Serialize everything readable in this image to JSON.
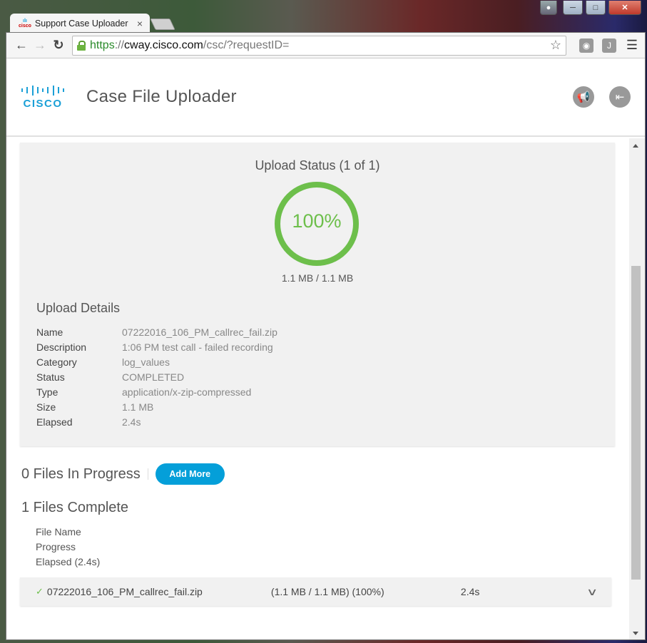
{
  "window": {
    "tab_title": "Support Case Uploader",
    "tab_close": "×",
    "favicon_text": "cisco"
  },
  "toolbar": {
    "url_scheme": "https",
    "url_sep": "://",
    "url_host": "cway.cisco.com",
    "url_path": "/csc/?requestID=",
    "extension_label": "J"
  },
  "header": {
    "logo_text": "CISCO",
    "title": "Case File Uploader"
  },
  "status": {
    "title": "Upload Status (1 of 1)",
    "percent_label": "100%",
    "progress_fraction": 1.0,
    "ring_color": "#6dbf4b",
    "size_label": "1.1 MB / 1.1 MB"
  },
  "details": {
    "title": "Upload Details",
    "rows": [
      {
        "label": "Name",
        "value": "07222016_106_PM_callrec_fail.zip"
      },
      {
        "label": "Description",
        "value": "1:06 PM test call - failed recording"
      },
      {
        "label": "Category",
        "value": "log_values"
      },
      {
        "label": "Status",
        "value": "COMPLETED"
      },
      {
        "label": "Type",
        "value": "application/x-zip-compressed"
      },
      {
        "label": "Size",
        "value": "1.1 MB"
      },
      {
        "label": "Elapsed",
        "value": "2.4s"
      }
    ]
  },
  "in_progress": {
    "title": "0 Files In Progress",
    "add_more_label": "Add More",
    "accent": "#049fd9"
  },
  "complete": {
    "title": "1 Files Complete",
    "columns": [
      "File Name",
      "Progress",
      "Elapsed (2.4s)"
    ],
    "files": [
      {
        "name": "07222016_106_PM_callrec_fail.zip",
        "progress": "(1.1 MB / 1.1 MB) (100%)",
        "elapsed": "2.4s"
      }
    ]
  }
}
